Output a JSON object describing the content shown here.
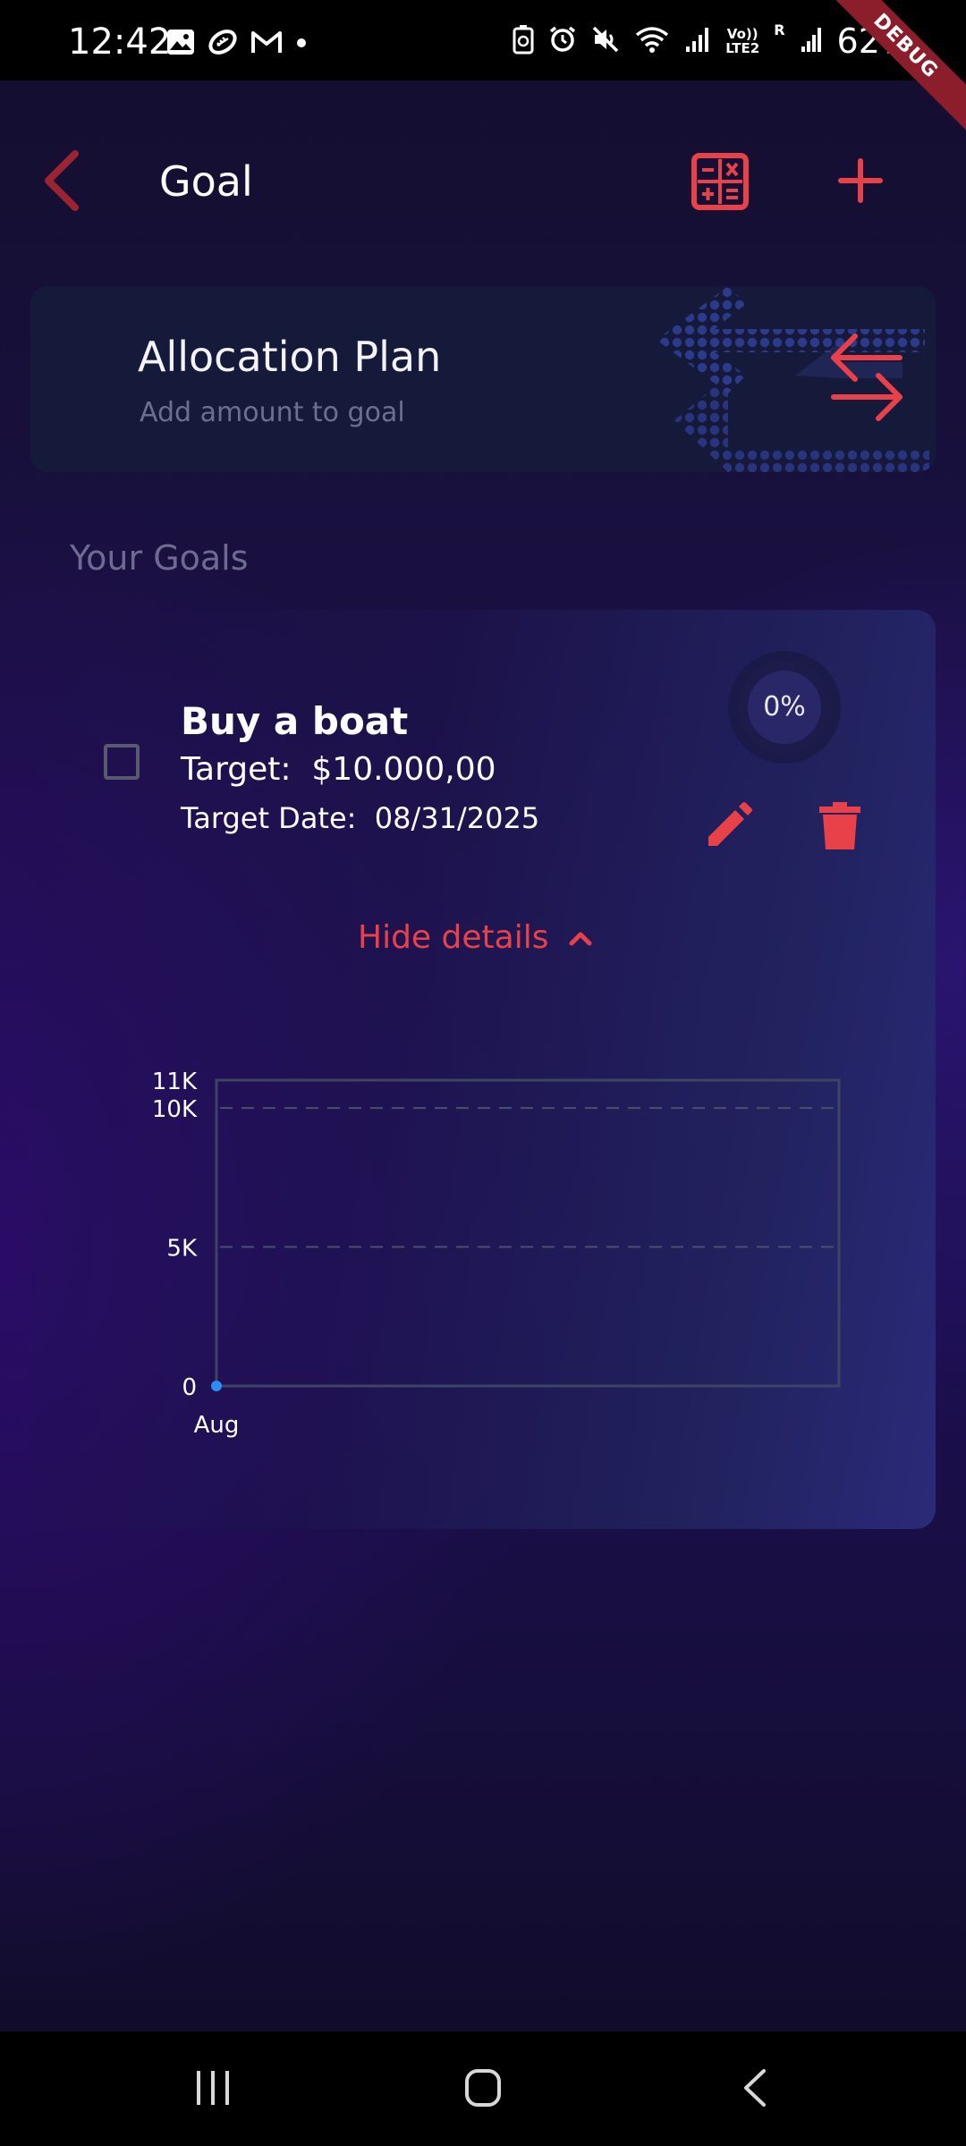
{
  "status_bar": {
    "time": "12:42",
    "battery": "62%",
    "debug_label": "DEBUG",
    "network_label": "Vo)) LTE2",
    "roaming_label": "R"
  },
  "appbar": {
    "title": "Goal"
  },
  "allocation_card": {
    "title": "Allocation Plan",
    "subtitle": "Add amount to goal"
  },
  "goals_section": {
    "label": "Your Goals"
  },
  "goal": {
    "name": "Buy a boat",
    "target": "Target:  $10.000,00",
    "target_date": "Target Date:  08/31/2025",
    "progress_label": "0%",
    "progress_fraction": 0,
    "toggle_label": "Hide details"
  },
  "colors": {
    "accent": "#e8414a",
    "background": "#1b1045",
    "card": "#161a3a",
    "chart_point": "#2f8cf0"
  },
  "icons": {
    "back": "chevron-left-icon",
    "calculator": "calculator-icon",
    "add": "plus-icon",
    "allocation": "swap-arrows-icon",
    "edit": "pencil-icon",
    "delete": "trash-icon",
    "toggle": "chevron-up-icon"
  },
  "chart_data": {
    "type": "line",
    "x": [
      "Aug"
    ],
    "series": [
      {
        "values": [
          0
        ]
      }
    ],
    "y_ticks": [
      0,
      5000,
      10000,
      11000
    ],
    "y_tick_labels": [
      "0",
      "5K",
      "10K",
      "11K"
    ],
    "ylim": [
      0,
      11000
    ],
    "grid": "horizontal dashed at 5K and 10K",
    "title": "",
    "xlabel": "",
    "ylabel": ""
  }
}
